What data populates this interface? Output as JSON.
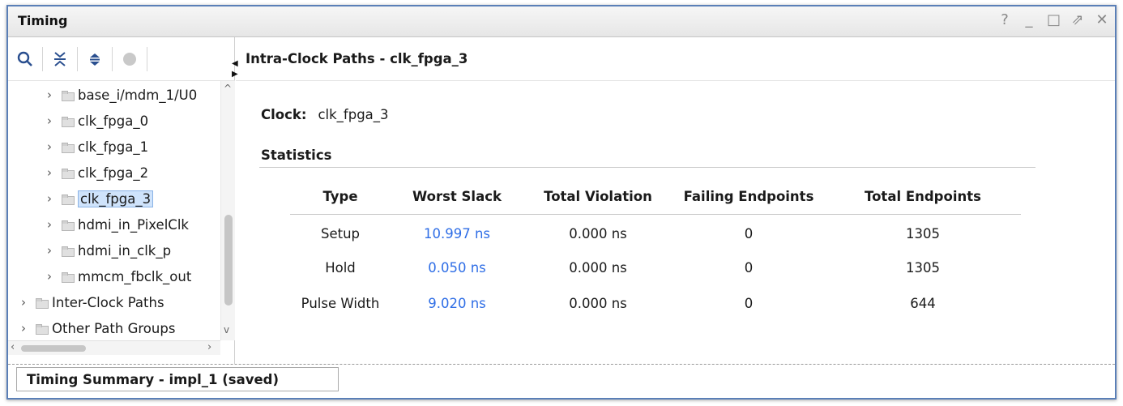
{
  "window": {
    "title": "Timing"
  },
  "window_controls": [
    "?",
    "_",
    "□",
    "⇗",
    "✕"
  ],
  "toolbar": {
    "buttons": [
      "search-icon",
      "collapse-all-icon",
      "expand-all-icon",
      "record-icon"
    ]
  },
  "tree": {
    "items": [
      {
        "label": "base_i/mdm_1/U0",
        "selected": false
      },
      {
        "label": "clk_fpga_0",
        "selected": false
      },
      {
        "label": "clk_fpga_1",
        "selected": false
      },
      {
        "label": "clk_fpga_2",
        "selected": false
      },
      {
        "label": "clk_fpga_3",
        "selected": true
      },
      {
        "label": "hdmi_in_PixelClk",
        "selected": false
      },
      {
        "label": "hdmi_in_clk_p",
        "selected": false
      },
      {
        "label": "mmcm_fbclk_out",
        "selected": false
      },
      {
        "label": "Inter-Clock Paths",
        "selected": false
      },
      {
        "label": "Other Path Groups",
        "selected": false
      }
    ]
  },
  "detail": {
    "heading": "Intra-Clock Paths - clk_fpga_3",
    "clock_label": "Clock:",
    "clock_value": "clk_fpga_3",
    "statistics_title": "Statistics",
    "table": {
      "headers": [
        "Type",
        "Worst Slack",
        "Total Violation",
        "Failing Endpoints",
        "Total Endpoints"
      ],
      "rows": [
        [
          "Setup",
          "10.997 ns",
          "0.000 ns",
          "0",
          "1305"
        ],
        [
          "Hold",
          "0.050 ns",
          "0.000 ns",
          "0",
          "1305"
        ],
        [
          "Pulse Width",
          "9.020 ns",
          "0.000 ns",
          "0",
          "644"
        ]
      ]
    }
  },
  "status_tab": {
    "label": "Timing Summary - impl_1 (saved)"
  },
  "colors": {
    "accent_border": "#5a7fb7",
    "link": "#2f6ee6",
    "selection": "#cfe3fb"
  }
}
